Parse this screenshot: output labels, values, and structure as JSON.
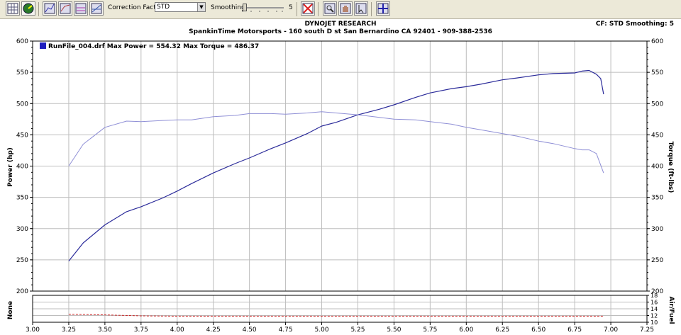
{
  "toolbar": {
    "correction_factor_label": "Correction Factor:",
    "correction_factor_value": "STD",
    "smoothing_label": "Smoothing:",
    "smoothing_value": "5",
    "smoothing_level": 5
  },
  "header": {
    "title": "DYNOJET RESEARCH",
    "subtitle": "SpankinTime Motorsports - 160 south D st San Bernardino CA 92401 - 909-388-2536",
    "right_info": "CF: STD  Smoothing: 5"
  },
  "legend": {
    "entry": "RunFile_004.drf Max Power = 554.32 Max Torque = 486.37",
    "color": "#1f1fbf"
  },
  "colors": {
    "power_line": "#2b2b9a",
    "torque_line": "#8f8fd6",
    "grid": "#bdbdbd",
    "lower_line": "#cc2222"
  },
  "chart_data": {
    "type": "line",
    "title": "",
    "xlabel": "",
    "ylabel": "Power (hp)",
    "ylabel_right": "Torque (ft-lbs)",
    "xlim": [
      3.0,
      7.25
    ],
    "ylim": [
      200,
      600
    ],
    "ylim_right": [
      200,
      600
    ],
    "x_ticks": [
      "3.00",
      "3.25",
      "3.50",
      "3.75",
      "4.00",
      "4.25",
      "4.50",
      "4.75",
      "5.00",
      "5.25",
      "5.50",
      "5.75",
      "6.00",
      "6.25",
      "6.50",
      "6.75",
      "7.00",
      "7.25"
    ],
    "y_ticks": [
      "200",
      "250",
      "300",
      "350",
      "400",
      "450",
      "500",
      "550",
      "600"
    ],
    "grid": true,
    "legend_position": "top-left",
    "series": [
      {
        "name": "Power (hp)",
        "x": [
          3.25,
          3.35,
          3.5,
          3.65,
          3.75,
          3.9,
          4.0,
          4.1,
          4.25,
          4.4,
          4.5,
          4.65,
          4.75,
          4.9,
          5.0,
          5.1,
          5.25,
          5.4,
          5.5,
          5.65,
          5.75,
          5.9,
          6.0,
          6.1,
          6.25,
          6.35,
          6.5,
          6.6,
          6.75,
          6.8,
          6.85,
          6.9,
          6.93,
          6.95
        ],
        "values": [
          248,
          277,
          306,
          327,
          335,
          349,
          360,
          372,
          389,
          404,
          413,
          428,
          437,
          452,
          464,
          470,
          482,
          491,
          498,
          510,
          517,
          524,
          527,
          531,
          538,
          541,
          546,
          548,
          549,
          552,
          553,
          547,
          540,
          515
        ]
      },
      {
        "name": "Torque (ft-lbs)",
        "x": [
          3.25,
          3.35,
          3.5,
          3.65,
          3.75,
          3.9,
          4.0,
          4.1,
          4.25,
          4.4,
          4.5,
          4.65,
          4.75,
          4.9,
          5.0,
          5.1,
          5.25,
          5.4,
          5.5,
          5.65,
          5.75,
          5.9,
          6.0,
          6.1,
          6.25,
          6.35,
          6.5,
          6.6,
          6.75,
          6.8,
          6.85,
          6.9,
          6.95
        ],
        "values": [
          400,
          435,
          462,
          472,
          471,
          473,
          474,
          474,
          479,
          481,
          484,
          484,
          483,
          485,
          487,
          485,
          482,
          478,
          475,
          474,
          471,
          467,
          462,
          458,
          452,
          448,
          440,
          436,
          428,
          426,
          426,
          420,
          389
        ]
      }
    ],
    "lower_panel": {
      "ylabel": "None",
      "ylabel_right": "Air/Fuel",
      "ylim": [
        10,
        18
      ],
      "y_ticks": [
        "10",
        "12",
        "14",
        "16",
        "18"
      ],
      "series": [
        {
          "x": [
            3.25,
            3.5,
            3.75,
            4.0,
            4.5,
            5.0,
            5.5,
            6.0,
            6.5,
            6.95
          ],
          "values": [
            12.4,
            12.2,
            11.9,
            11.8,
            11.8,
            11.8,
            11.8,
            11.8,
            11.8,
            11.8
          ]
        }
      ]
    }
  }
}
